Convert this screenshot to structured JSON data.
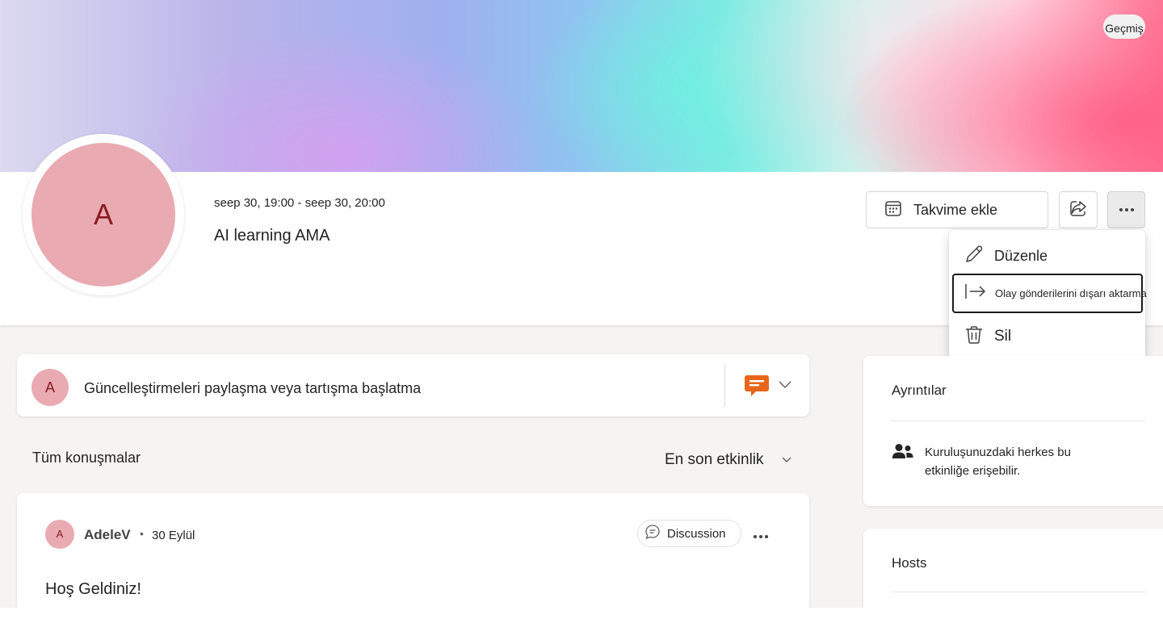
{
  "header": {
    "history_label": "Geçmiş",
    "avatar_initial": "A",
    "event_date": "seep 30, 19:00 - seep 30, 20:00",
    "event_title": "AI learning AMA",
    "add_calendar_label": "Takvime ekle"
  },
  "more_menu": {
    "items": [
      {
        "label": "Düzenle",
        "icon": "pencil-icon"
      },
      {
        "label": "Olay gönderilerini dışarı aktarma",
        "icon": "export-arrow-icon"
      },
      {
        "label": "Sil",
        "icon": "trash-icon"
      }
    ]
  },
  "composer": {
    "avatar_initial": "A",
    "prompt": "Güncelleştirmeleri paylaşma veya tartışma başlatma"
  },
  "conversations": {
    "label": "Tüm konuşmalar",
    "sort_label": "En son etkinlik"
  },
  "post": {
    "avatar_initial": "A",
    "author": "AdeleV",
    "separator": "•",
    "date": "30 Eylül",
    "tag": "Discussion",
    "body": "Hoş Geldiniz!"
  },
  "details": {
    "heading": "Ayrıntılar",
    "access_text": "Kuruluşunuzdaki herkes bu etkinliğe erişebilir."
  },
  "hosts": {
    "heading": "Hosts"
  },
  "colors": {
    "avatar_bg": "#eaaab1",
    "avatar_text": "#8a1c24",
    "accent_orange": "#e8661c"
  }
}
